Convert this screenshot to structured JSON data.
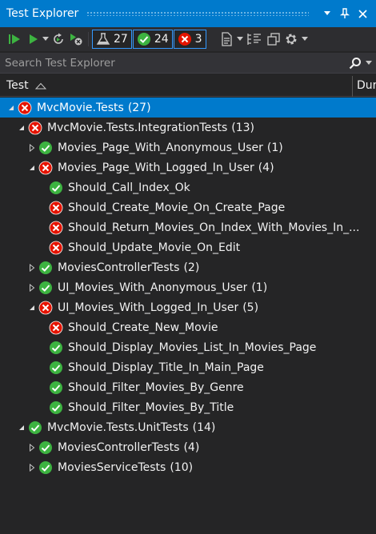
{
  "window": {
    "title": "Test Explorer"
  },
  "toolbar": {
    "counters": [
      {
        "name": "total",
        "value": "27",
        "color": "#f1f1f1"
      },
      {
        "name": "passed",
        "value": "24",
        "color": "#3db341"
      },
      {
        "name": "failed",
        "value": "3",
        "color": "#e51400"
      }
    ]
  },
  "search": {
    "placeholder": "Search Test Explorer",
    "value": ""
  },
  "columns": {
    "test": "Test",
    "duration": "Duration"
  },
  "colors": {
    "pass": "#3db341",
    "fail": "#e51400",
    "selected": "#007acc",
    "accent": "#007acc"
  },
  "tree": [
    {
      "level": 0,
      "expander": "expanded",
      "status": "fail",
      "label": "MvcMovie.Tests",
      "count": "(27)",
      "selected": true
    },
    {
      "level": 1,
      "expander": "expanded",
      "status": "fail",
      "label": "MvcMovie.Tests.IntegrationTests",
      "count": "(13)"
    },
    {
      "level": 2,
      "expander": "collapsed",
      "status": "pass",
      "label": "Movies_Page_With_Anonymous_User",
      "count": "(1)"
    },
    {
      "level": 2,
      "expander": "expanded",
      "status": "fail",
      "label": "Movies_Page_With_Logged_In_User",
      "count": "(4)"
    },
    {
      "level": 3,
      "expander": "none",
      "status": "pass",
      "label": "Should_Call_Index_Ok",
      "count": ""
    },
    {
      "level": 3,
      "expander": "none",
      "status": "fail",
      "label": "Should_Create_Movie_On_Create_Page",
      "count": ""
    },
    {
      "level": 3,
      "expander": "none",
      "status": "fail",
      "label": "Should_Return_Movies_On_Index_With_Movies_In_...",
      "count": ""
    },
    {
      "level": 3,
      "expander": "none",
      "status": "fail",
      "label": "Should_Update_Movie_On_Edit",
      "count": ""
    },
    {
      "level": 2,
      "expander": "collapsed",
      "status": "pass",
      "label": "MoviesControllerTests",
      "count": "(2)"
    },
    {
      "level": 2,
      "expander": "collapsed",
      "status": "pass",
      "label": "UI_Movies_With_Anonymous_User",
      "count": "(1)"
    },
    {
      "level": 2,
      "expander": "expanded",
      "status": "fail",
      "label": "UI_Movies_With_Logged_In_User",
      "count": "(5)"
    },
    {
      "level": 3,
      "expander": "none",
      "status": "fail",
      "label": "Should_Create_New_Movie",
      "count": ""
    },
    {
      "level": 3,
      "expander": "none",
      "status": "pass",
      "label": "Should_Display_Movies_List_In_Movies_Page",
      "count": ""
    },
    {
      "level": 3,
      "expander": "none",
      "status": "pass",
      "label": "Should_Display_Title_In_Main_Page",
      "count": ""
    },
    {
      "level": 3,
      "expander": "none",
      "status": "pass",
      "label": "Should_Filter_Movies_By_Genre",
      "count": ""
    },
    {
      "level": 3,
      "expander": "none",
      "status": "pass",
      "label": "Should_Filter_Movies_By_Title",
      "count": ""
    },
    {
      "level": 1,
      "expander": "expanded",
      "status": "pass",
      "label": "MvcMovie.Tests.UnitTests",
      "count": "(14)"
    },
    {
      "level": 2,
      "expander": "collapsed",
      "status": "pass",
      "label": "MoviesControllerTests",
      "count": "(4)"
    },
    {
      "level": 2,
      "expander": "collapsed",
      "status": "pass",
      "label": "MoviesServiceTests",
      "count": "(10)"
    }
  ]
}
